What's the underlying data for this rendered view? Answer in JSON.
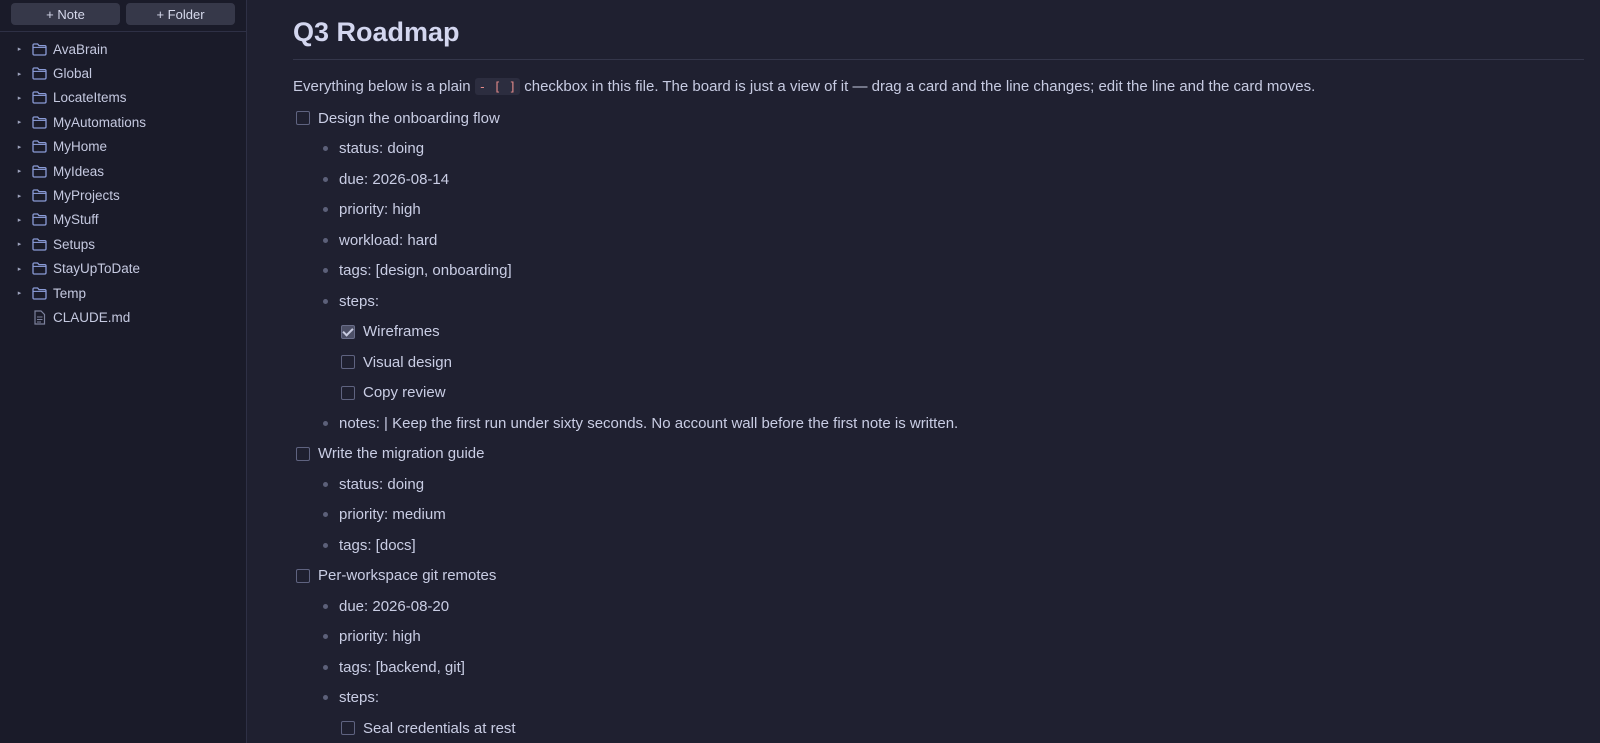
{
  "sidebar": {
    "new_note": "+ Note",
    "new_folder": "+ Folder",
    "folders": [
      "AvaBrain",
      "Global",
      "LocateItems",
      "MyAutomations",
      "MyHome",
      "MyIdeas",
      "MyProjects",
      "MyStuff",
      "Setups",
      "StayUpToDate",
      "Temp"
    ],
    "files": [
      "CLAUDE.md"
    ]
  },
  "doc": {
    "title": "Q3 Roadmap",
    "intro_before": "Everything below is a plain",
    "intro_code": "- [ ]",
    "intro_after": "checkbox in this file. The board is just a view of it — drag a card and the line changes; edit the line and the card moves.",
    "lines": [
      {
        "level": 0,
        "kind": "checkbox",
        "checked": false,
        "text": "Design the onboarding flow"
      },
      {
        "level": 1,
        "kind": "bullet",
        "text": "status: doing"
      },
      {
        "level": 1,
        "kind": "bullet",
        "text": "due: 2026-08-14"
      },
      {
        "level": 1,
        "kind": "bullet",
        "text": "priority: high"
      },
      {
        "level": 1,
        "kind": "bullet",
        "text": "workload: hard"
      },
      {
        "level": 1,
        "kind": "bullet",
        "text": "tags: [design, onboarding]"
      },
      {
        "level": 1,
        "kind": "bullet",
        "text": "steps:"
      },
      {
        "level": 2,
        "kind": "checkbox",
        "checked": true,
        "text": "Wireframes"
      },
      {
        "level": 2,
        "kind": "checkbox",
        "checked": false,
        "text": "Visual design"
      },
      {
        "level": 2,
        "kind": "checkbox",
        "checked": false,
        "text": "Copy review"
      },
      {
        "level": 1,
        "kind": "bullet",
        "text": "notes: | Keep the first run under sixty seconds. No account wall before the first note is written."
      },
      {
        "level": 0,
        "kind": "checkbox",
        "checked": false,
        "text": "Write the migration guide"
      },
      {
        "level": 1,
        "kind": "bullet",
        "text": "status: doing"
      },
      {
        "level": 1,
        "kind": "bullet",
        "text": "priority: medium"
      },
      {
        "level": 1,
        "kind": "bullet",
        "text": "tags: [docs]"
      },
      {
        "level": 0,
        "kind": "checkbox",
        "checked": false,
        "text": "Per-workspace git remotes"
      },
      {
        "level": 1,
        "kind": "bullet",
        "text": "due: 2026-08-20"
      },
      {
        "level": 1,
        "kind": "bullet",
        "text": "priority: high"
      },
      {
        "level": 1,
        "kind": "bullet",
        "text": "tags: [backend, git]"
      },
      {
        "level": 1,
        "kind": "bullet",
        "text": "steps:"
      },
      {
        "level": 2,
        "kind": "checkbox",
        "checked": false,
        "text": "Seal credentials at rest"
      }
    ]
  },
  "icons": {
    "folder": "folder-icon",
    "file": "file-icon",
    "caret": "caret-right-icon"
  },
  "colors": {
    "background": "#1f2030",
    "sidebar": "#1a1b29",
    "code_text": "#e58b8b"
  }
}
